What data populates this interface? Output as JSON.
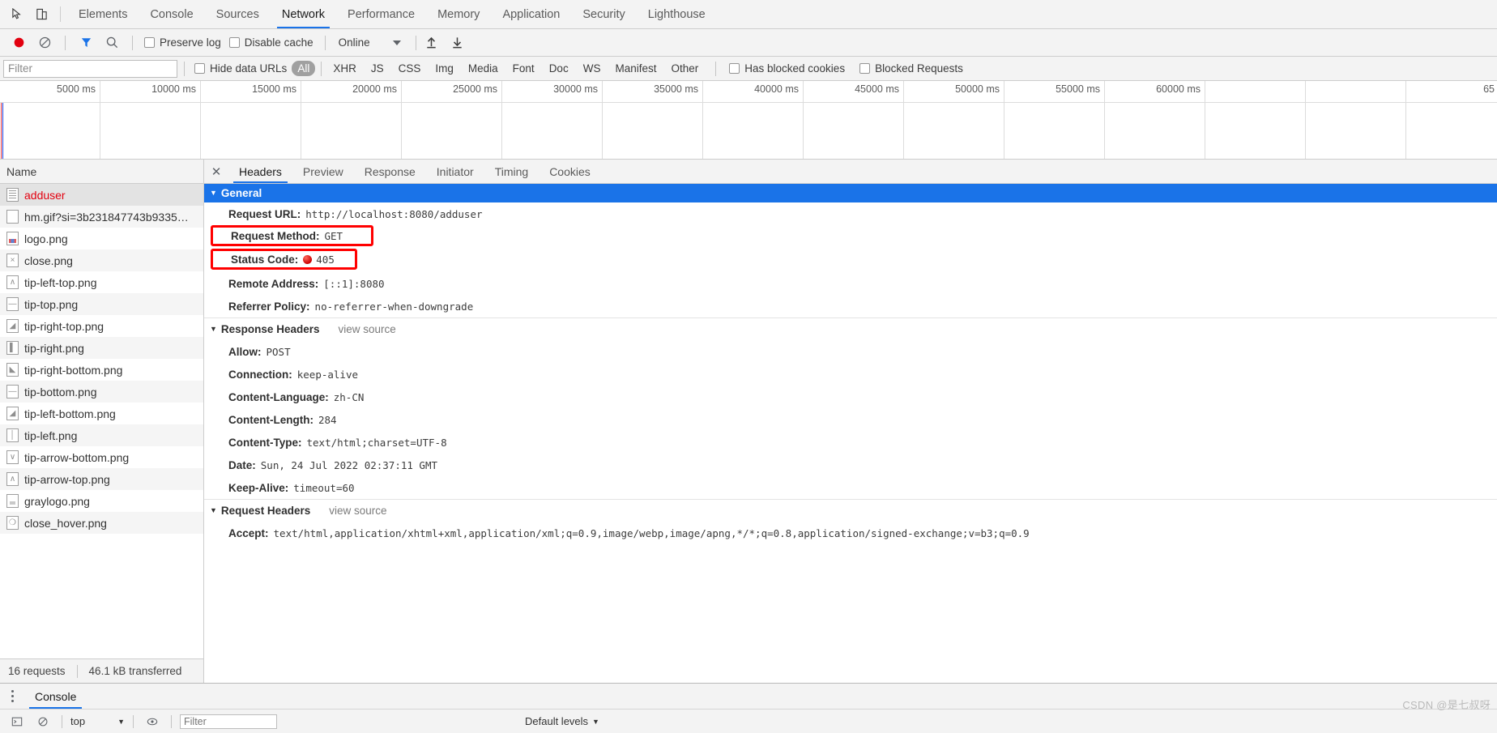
{
  "toolbar": {
    "inspect_icon": "cursor-select-icon",
    "device_icon": "device-toolbar-icon",
    "tabs": [
      {
        "label": "Elements",
        "active": false
      },
      {
        "label": "Console",
        "active": false
      },
      {
        "label": "Sources",
        "active": false
      },
      {
        "label": "Network",
        "active": true
      },
      {
        "label": "Performance",
        "active": false
      },
      {
        "label": "Memory",
        "active": false
      },
      {
        "label": "Application",
        "active": false
      },
      {
        "label": "Security",
        "active": false
      },
      {
        "label": "Lighthouse",
        "active": false
      }
    ]
  },
  "controls": {
    "record_icon": "record-stop-icon",
    "clear_icon": "clear-icon",
    "filter_icon": "filter-funnel-icon",
    "search_icon": "search-icon",
    "preserve_log_label": "Preserve log",
    "preserve_log_checked": false,
    "disable_cache_label": "Disable cache",
    "disable_cache_checked": false,
    "throttle_value": "Online",
    "import_icon": "import-har-icon",
    "export_icon": "export-har-icon"
  },
  "filterbar": {
    "filter_placeholder": "Filter",
    "filter_value": "",
    "hide_data_urls_label": "Hide data URLs",
    "hide_data_urls_checked": false,
    "types": [
      "All",
      "XHR",
      "JS",
      "CSS",
      "Img",
      "Media",
      "Font",
      "Doc",
      "WS",
      "Manifest",
      "Other"
    ],
    "active_type": "All",
    "has_blocked_cookies_label": "Has blocked cookies",
    "has_blocked_cookies_checked": false,
    "blocked_requests_label": "Blocked Requests",
    "blocked_requests_checked": false
  },
  "overview": {
    "ticks": [
      "5000 ms",
      "10000 ms",
      "15000 ms",
      "20000 ms",
      "25000 ms",
      "30000 ms",
      "35000 ms",
      "40000 ms",
      "45000 ms",
      "50000 ms",
      "55000 ms",
      "60000 ms",
      "65"
    ]
  },
  "requests": {
    "column_header": "Name",
    "rows": [
      {
        "name": "adduser",
        "icon": "document-icon",
        "error": true,
        "selected": true
      },
      {
        "name": "hm.gif?si=3b231847743b9335…",
        "icon": "blank-file-icon",
        "error": false,
        "selected": false
      },
      {
        "name": "logo.png",
        "icon": "image-logo-icon",
        "error": false,
        "selected": false
      },
      {
        "name": "close.png",
        "icon": "image-close-icon",
        "error": false,
        "selected": false
      },
      {
        "name": "tip-left-top.png",
        "icon": "image-caret-up-icon",
        "error": false,
        "selected": false
      },
      {
        "name": "tip-top.png",
        "icon": "image-dash-icon",
        "error": false,
        "selected": false
      },
      {
        "name": "tip-right-top.png",
        "icon": "image-tip-right-top-icon",
        "error": false,
        "selected": false
      },
      {
        "name": "tip-right.png",
        "icon": "image-bar-icon",
        "error": false,
        "selected": false
      },
      {
        "name": "tip-right-bottom.png",
        "icon": "image-tip-right-bottom-icon",
        "error": false,
        "selected": false
      },
      {
        "name": "tip-bottom.png",
        "icon": "image-dash-icon",
        "error": false,
        "selected": false
      },
      {
        "name": "tip-left-bottom.png",
        "icon": "image-tip-left-bottom-icon",
        "error": false,
        "selected": false
      },
      {
        "name": "tip-left.png",
        "icon": "image-pipe-icon",
        "error": false,
        "selected": false
      },
      {
        "name": "tip-arrow-bottom.png",
        "icon": "image-caret-down-icon",
        "error": false,
        "selected": false
      },
      {
        "name": "tip-arrow-top.png",
        "icon": "image-caret-up-icon",
        "error": false,
        "selected": false
      },
      {
        "name": "graylogo.png",
        "icon": "image-graylogo-icon",
        "error": false,
        "selected": false
      },
      {
        "name": "close_hover.png",
        "icon": "image-close-hover-icon",
        "error": false,
        "selected": false
      }
    ],
    "status": {
      "requests_count": "16 requests",
      "transferred": "46.1 kB transferred"
    }
  },
  "detail": {
    "close_icon": "close-icon",
    "tabs": [
      {
        "label": "Headers",
        "active": true
      },
      {
        "label": "Preview",
        "active": false
      },
      {
        "label": "Response",
        "active": false
      },
      {
        "label": "Initiator",
        "active": false
      },
      {
        "label": "Timing",
        "active": false
      },
      {
        "label": "Cookies",
        "active": false
      }
    ],
    "general": {
      "title": "General",
      "rows": [
        {
          "key": "Request URL:",
          "value": "http://localhost:8080/adduser",
          "highlight": false,
          "status_dot": false
        },
        {
          "key": "Request Method:",
          "value": "GET",
          "highlight": true,
          "status_dot": false
        },
        {
          "key": "Status Code:",
          "value": "405",
          "highlight": true,
          "status_dot": true
        },
        {
          "key": "Remote Address:",
          "value": "[::1]:8080",
          "highlight": false,
          "status_dot": false
        },
        {
          "key": "Referrer Policy:",
          "value": "no-referrer-when-downgrade",
          "highlight": false,
          "status_dot": false
        }
      ]
    },
    "response_headers": {
      "title": "Response Headers",
      "view_source": "view source",
      "rows": [
        {
          "key": "Allow:",
          "value": "POST"
        },
        {
          "key": "Connection:",
          "value": "keep-alive"
        },
        {
          "key": "Content-Language:",
          "value": "zh-CN"
        },
        {
          "key": "Content-Length:",
          "value": "284"
        },
        {
          "key": "Content-Type:",
          "value": "text/html;charset=UTF-8"
        },
        {
          "key": "Date:",
          "value": "Sun, 24 Jul 2022 02:37:11 GMT"
        },
        {
          "key": "Keep-Alive:",
          "value": "timeout=60"
        }
      ]
    },
    "request_headers": {
      "title": "Request Headers",
      "view_source": "view source",
      "rows": [
        {
          "key": "Accept:",
          "value": "text/html,application/xhtml+xml,application/xml;q=0.9,image/webp,image/apng,*/*;q=0.8,application/signed-exchange;v=b3;q=0.9"
        }
      ]
    }
  },
  "drawer": {
    "menu_icon": "more-options-icon",
    "tabs": [
      {
        "label": "Console",
        "active": true
      }
    ],
    "execute_icon": "execution-context-icon",
    "clear_icon": "clear-console-icon",
    "context_value": "top",
    "eye_icon": "live-expression-icon",
    "filter_placeholder": "Filter",
    "levels_label": "Default levels"
  },
  "watermark": "CSDN @是七叔呀",
  "colors": {
    "accent": "#1a73e8",
    "error_red": "#e3000f",
    "highlight_box": "#ff0000",
    "chrome_bg": "#f3f3f3"
  }
}
